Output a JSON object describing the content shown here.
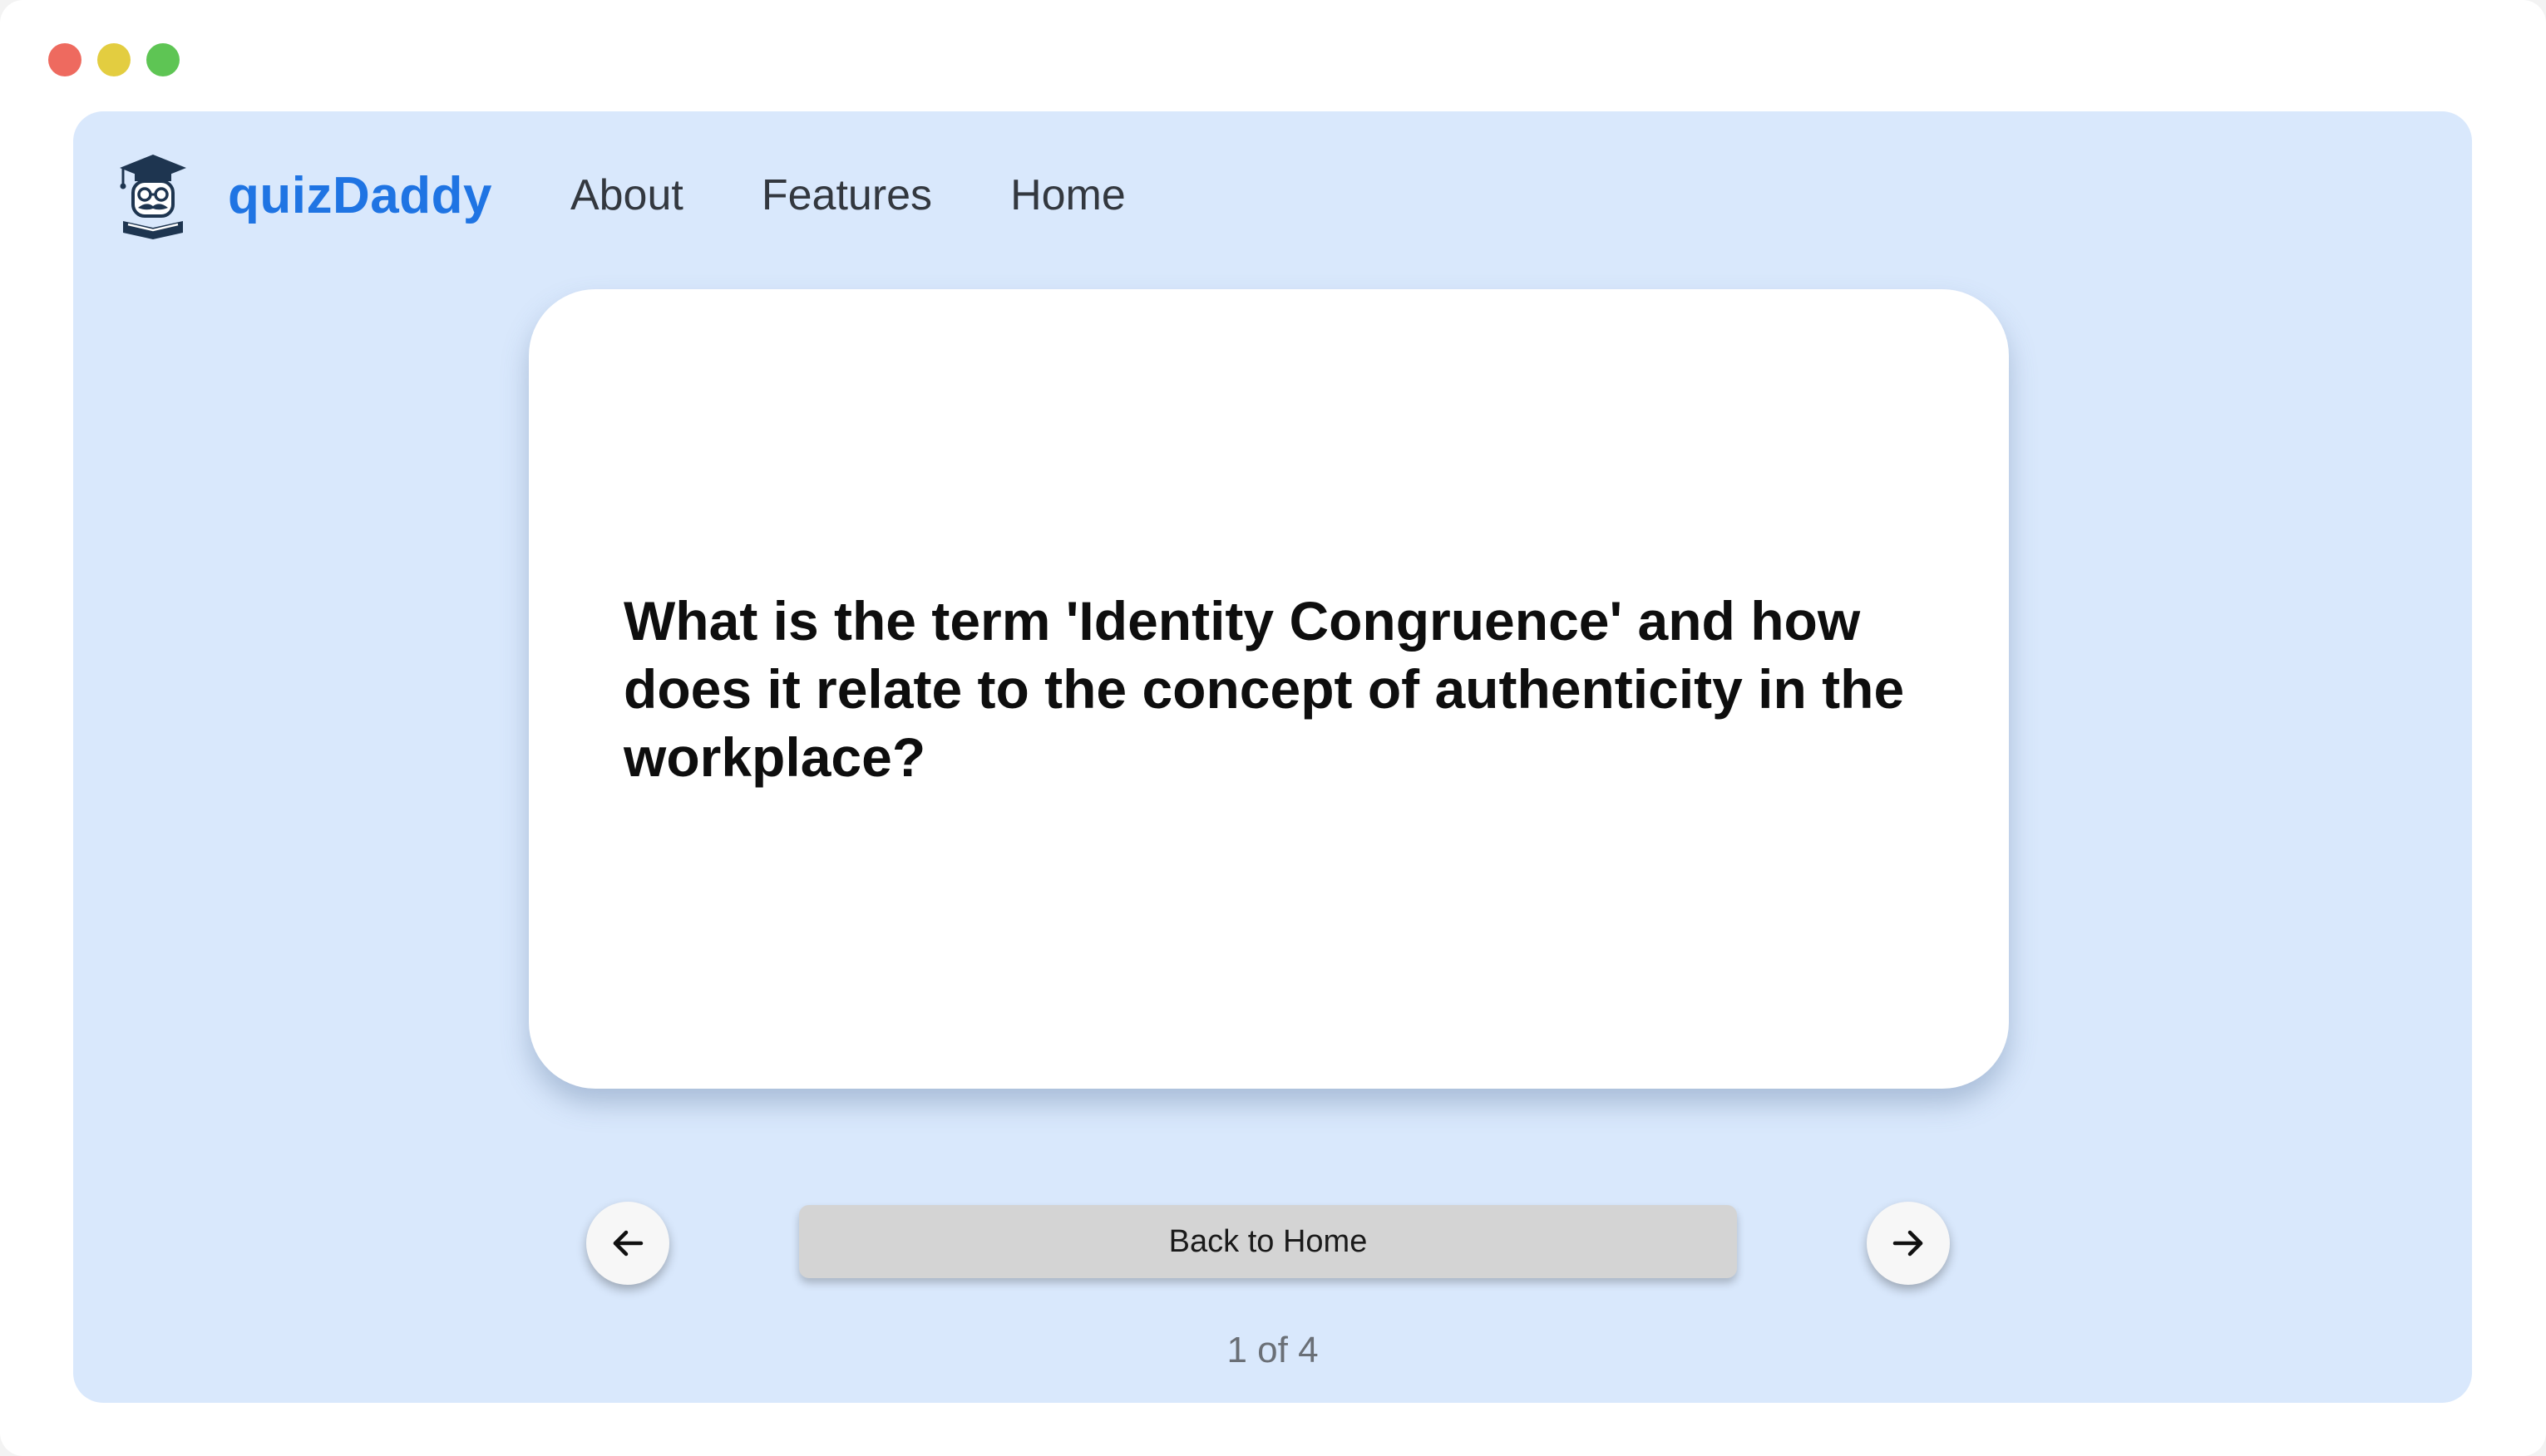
{
  "window": {
    "controls": [
      "close",
      "minimize",
      "maximize"
    ]
  },
  "header": {
    "logo_icon": "graduate-mustache-icon",
    "brand": "quizDaddy",
    "nav": [
      {
        "label": "About"
      },
      {
        "label": "Features"
      },
      {
        "label": "Home"
      }
    ]
  },
  "flashcard": {
    "question": "What is the term 'Identity Congruence' and how does it relate to the concept of authenticity in the workplace?"
  },
  "controls": {
    "prev_icon": "arrow-left-icon",
    "next_icon": "arrow-right-icon",
    "back_label": "Back to Home",
    "counter": "1 of 4"
  },
  "colors": {
    "brand": "#1f74e3",
    "app_background": "#d9e8fc",
    "card": "#ffffff",
    "button": "#d4d4d4"
  }
}
